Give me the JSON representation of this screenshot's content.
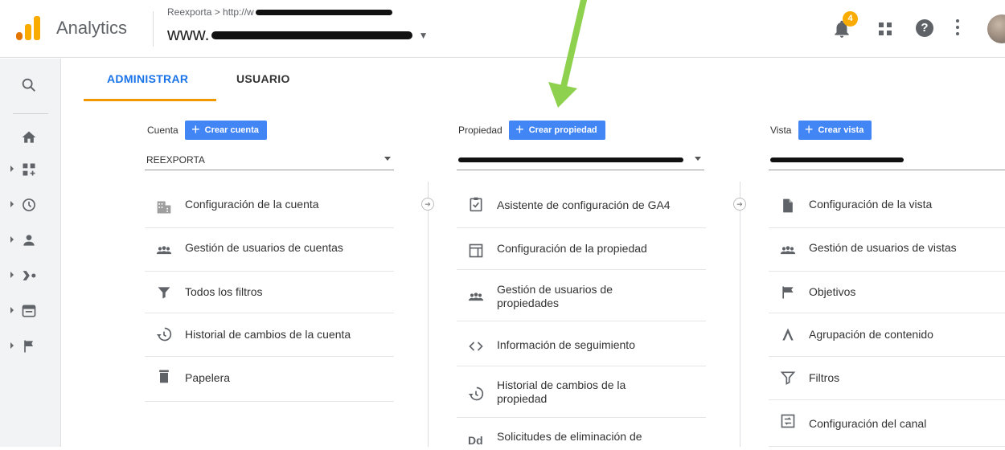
{
  "header": {
    "app_title": "Analytics",
    "breadcrumb": "Reexporta > http://w",
    "property_selector": "www.",
    "notification_count": "4"
  },
  "tabs": {
    "admin": "ADMINISTRAR",
    "user": "USUARIO"
  },
  "account": {
    "label": "Cuenta",
    "create": "Crear cuenta",
    "selected": "REEXPORTA",
    "items": [
      {
        "label": "Configuración de la cuenta",
        "icon": "building-icon"
      },
      {
        "label": "Gestión de usuarios de cuentas",
        "icon": "people-icon"
      },
      {
        "label": "Todos los filtros",
        "icon": "filter-icon"
      },
      {
        "label": "Historial de cambios de la cuenta",
        "icon": "history-icon"
      },
      {
        "label": "Papelera",
        "icon": "trash-icon"
      }
    ]
  },
  "property": {
    "label": "Propiedad",
    "create": "Crear propiedad",
    "items": [
      {
        "label": "Asistente de configuración de GA4",
        "icon": "checklist-icon"
      },
      {
        "label": "Configuración de la propiedad",
        "icon": "window-icon"
      },
      {
        "label": "Gestión de usuarios de propiedades",
        "icon": "people-icon"
      },
      {
        "label": "Información de seguimiento",
        "icon": "code-icon"
      },
      {
        "label": "Historial de cambios de la propiedad",
        "icon": "history-icon"
      },
      {
        "label": "Solicitudes de eliminación de",
        "icon": "dd-icon"
      }
    ]
  },
  "view": {
    "label": "Vista",
    "create": "Crear vista",
    "items": [
      {
        "label": "Configuración de la vista",
        "icon": "file-icon"
      },
      {
        "label": "Gestión de usuarios de vistas",
        "icon": "people-icon"
      },
      {
        "label": "Objetivos",
        "icon": "flag-icon"
      },
      {
        "label": "Agrupación de contenido",
        "icon": "walk-icon"
      },
      {
        "label": "Filtros",
        "icon": "filter-icon"
      },
      {
        "label": "Configuración del canal",
        "icon": "channel-icon"
      }
    ]
  },
  "colors": {
    "accent_blue": "#1a73e8",
    "button_blue": "#4285f4",
    "tab_underline": "#f29900",
    "badge": "#f9ab00",
    "arrow": "#8ed14f"
  }
}
